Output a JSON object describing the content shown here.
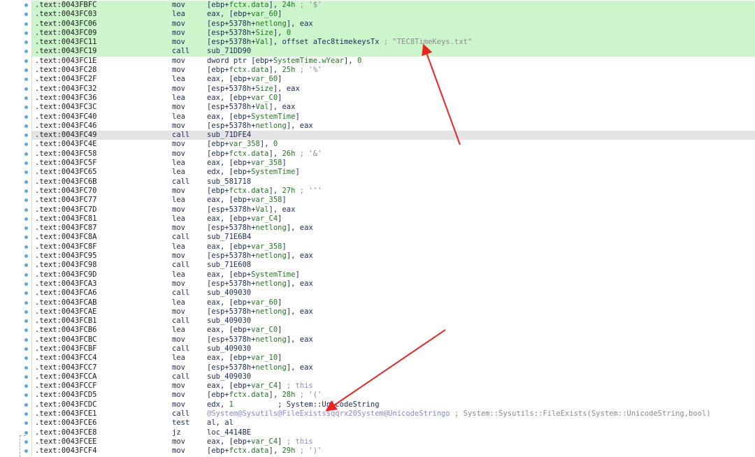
{
  "rows": [
    {
      "addr": ".text:0043FBFC",
      "mn": "mov",
      "ops": [
        [
          "[ebp+",
          "n"
        ],
        [
          "fctx.data",
          "g"
        ],
        [
          "], ",
          "n"
        ],
        [
          "24h",
          "g"
        ],
        [
          " ; '$'",
          "c"
        ]
      ],
      "hl": "green"
    },
    {
      "addr": ".text:0043FC03",
      "mn": "lea",
      "ops": [
        [
          "eax, [ebp+",
          "n"
        ],
        [
          "var_60",
          "g"
        ],
        [
          "]",
          "n"
        ]
      ],
      "hl": "green"
    },
    {
      "addr": ".text:0043FC06",
      "mn": "mov",
      "ops": [
        [
          "[esp+5378h+",
          "n"
        ],
        [
          "netlong",
          "g"
        ],
        [
          "], eax",
          "n"
        ]
      ],
      "hl": "green"
    },
    {
      "addr": ".text:0043FC09",
      "mn": "mov",
      "ops": [
        [
          "[esp+5378h+",
          "n"
        ],
        [
          "Size",
          "g"
        ],
        [
          "], ",
          "n"
        ],
        [
          "0",
          "g"
        ]
      ],
      "hl": "green"
    },
    {
      "addr": ".text:0043FC11",
      "mn": "mov",
      "ops": [
        [
          "[esp+5378h+",
          "n"
        ],
        [
          "Val",
          "g"
        ],
        [
          "], offset aTec8timekeysTx",
          "n"
        ],
        [
          " ; \"TEC8TimeKeys.txt\"",
          "c"
        ]
      ],
      "hl": "green"
    },
    {
      "addr": ".text:0043FC19",
      "mn": "call",
      "ops": [
        [
          "sub_71DD90",
          "n"
        ]
      ],
      "hl": "green"
    },
    {
      "addr": ".text:0043FC1E",
      "mn": "mov",
      "ops": [
        [
          "dword ptr [ebp+",
          "n"
        ],
        [
          "SystemTime.wYear",
          "g"
        ],
        [
          "], ",
          "n"
        ],
        [
          "0",
          "g"
        ]
      ]
    },
    {
      "addr": ".text:0043FC28",
      "mn": "mov",
      "ops": [
        [
          "[ebp+",
          "n"
        ],
        [
          "fctx.data",
          "g"
        ],
        [
          "], ",
          "n"
        ],
        [
          "25h",
          "g"
        ],
        [
          " ; '%'",
          "c"
        ]
      ]
    },
    {
      "addr": ".text:0043FC2F",
      "mn": "lea",
      "ops": [
        [
          "eax, [ebp+",
          "n"
        ],
        [
          "var_60",
          "g"
        ],
        [
          "]",
          "n"
        ]
      ]
    },
    {
      "addr": ".text:0043FC32",
      "mn": "mov",
      "ops": [
        [
          "[esp+5378h+",
          "n"
        ],
        [
          "Size",
          "g"
        ],
        [
          "], eax",
          "n"
        ]
      ]
    },
    {
      "addr": ".text:0043FC36",
      "mn": "lea",
      "ops": [
        [
          "eax, [ebp+",
          "n"
        ],
        [
          "var_C0",
          "g"
        ],
        [
          "]",
          "n"
        ]
      ]
    },
    {
      "addr": ".text:0043FC3C",
      "mn": "mov",
      "ops": [
        [
          "[esp+5378h+",
          "n"
        ],
        [
          "Val",
          "g"
        ],
        [
          "], eax",
          "n"
        ]
      ]
    },
    {
      "addr": ".text:0043FC40",
      "mn": "lea",
      "ops": [
        [
          "eax, [ebp+",
          "n"
        ],
        [
          "SystemTime",
          "g"
        ],
        [
          "]",
          "n"
        ]
      ]
    },
    {
      "addr": ".text:0043FC46",
      "mn": "mov",
      "ops": [
        [
          "[esp+5378h+",
          "n"
        ],
        [
          "netlong",
          "g"
        ],
        [
          "], eax",
          "n"
        ]
      ]
    },
    {
      "addr": ".text:0043FC49",
      "mn": "call",
      "ops": [
        [
          "sub_71DFE4",
          "n"
        ]
      ],
      "hl": "grey"
    },
    {
      "addr": ".text:0043FC4E",
      "mn": "mov",
      "ops": [
        [
          "[ebp+",
          "n"
        ],
        [
          "var_358",
          "g"
        ],
        [
          "], ",
          "n"
        ],
        [
          "0",
          "g"
        ]
      ]
    },
    {
      "addr": ".text:0043FC58",
      "mn": "mov",
      "ops": [
        [
          "[ebp+",
          "n"
        ],
        [
          "fctx.data",
          "g"
        ],
        [
          "], ",
          "n"
        ],
        [
          "26h",
          "g"
        ],
        [
          " ; '&'",
          "c"
        ]
      ]
    },
    {
      "addr": ".text:0043FC5F",
      "mn": "lea",
      "ops": [
        [
          "eax, [ebp+",
          "n"
        ],
        [
          "var_358",
          "g"
        ],
        [
          "]",
          "n"
        ]
      ]
    },
    {
      "addr": ".text:0043FC65",
      "mn": "lea",
      "ops": [
        [
          "edx, [ebp+",
          "n"
        ],
        [
          "SystemTime",
          "g"
        ],
        [
          "]",
          "n"
        ]
      ]
    },
    {
      "addr": ".text:0043FC6B",
      "mn": "call",
      "ops": [
        [
          "sub_581718",
          "n"
        ]
      ]
    },
    {
      "addr": ".text:0043FC70",
      "mn": "mov",
      "ops": [
        [
          "[ebp+",
          "n"
        ],
        [
          "fctx.data",
          "g"
        ],
        [
          "], ",
          "n"
        ],
        [
          "27h",
          "g"
        ],
        [
          " ; '''",
          "c"
        ]
      ]
    },
    {
      "addr": ".text:0043FC77",
      "mn": "lea",
      "ops": [
        [
          "eax, [ebp+",
          "n"
        ],
        [
          "var_358",
          "g"
        ],
        [
          "]",
          "n"
        ]
      ]
    },
    {
      "addr": ".text:0043FC7D",
      "mn": "mov",
      "ops": [
        [
          "[esp+5378h+",
          "n"
        ],
        [
          "Val",
          "g"
        ],
        [
          "], eax",
          "n"
        ]
      ]
    },
    {
      "addr": ".text:0043FC81",
      "mn": "lea",
      "ops": [
        [
          "eax, [ebp+",
          "n"
        ],
        [
          "var_C4",
          "g"
        ],
        [
          "]",
          "n"
        ]
      ]
    },
    {
      "addr": ".text:0043FC87",
      "mn": "mov",
      "ops": [
        [
          "[esp+5378h+",
          "n"
        ],
        [
          "netlong",
          "g"
        ],
        [
          "], eax",
          "n"
        ]
      ]
    },
    {
      "addr": ".text:0043FC8A",
      "mn": "call",
      "ops": [
        [
          "sub_71E6B4",
          "n"
        ]
      ]
    },
    {
      "addr": ".text:0043FC8F",
      "mn": "lea",
      "ops": [
        [
          "eax, [ebp+",
          "n"
        ],
        [
          "var_358",
          "g"
        ],
        [
          "]",
          "n"
        ]
      ]
    },
    {
      "addr": ".text:0043FC95",
      "mn": "mov",
      "ops": [
        [
          "[esp+5378h+",
          "n"
        ],
        [
          "netlong",
          "g"
        ],
        [
          "], eax",
          "n"
        ]
      ]
    },
    {
      "addr": ".text:0043FC98",
      "mn": "call",
      "ops": [
        [
          "sub_71E608",
          "n"
        ]
      ]
    },
    {
      "addr": ".text:0043FC9D",
      "mn": "lea",
      "ops": [
        [
          "eax, [ebp+",
          "n"
        ],
        [
          "SystemTime",
          "g"
        ],
        [
          "]",
          "n"
        ]
      ]
    },
    {
      "addr": ".text:0043FCA3",
      "mn": "mov",
      "ops": [
        [
          "[esp+5378h+",
          "n"
        ],
        [
          "netlong",
          "g"
        ],
        [
          "], eax",
          "n"
        ]
      ]
    },
    {
      "addr": ".text:0043FCA6",
      "mn": "call",
      "ops": [
        [
          "sub_409030",
          "n"
        ]
      ]
    },
    {
      "addr": ".text:0043FCAB",
      "mn": "lea",
      "ops": [
        [
          "eax, [ebp+",
          "n"
        ],
        [
          "var_60",
          "g"
        ],
        [
          "]",
          "n"
        ]
      ]
    },
    {
      "addr": ".text:0043FCAE",
      "mn": "mov",
      "ops": [
        [
          "[esp+5378h+",
          "n"
        ],
        [
          "netlong",
          "g"
        ],
        [
          "], eax",
          "n"
        ]
      ]
    },
    {
      "addr": ".text:0043FCB1",
      "mn": "call",
      "ops": [
        [
          "sub_409030",
          "n"
        ]
      ]
    },
    {
      "addr": ".text:0043FCB6",
      "mn": "lea",
      "ops": [
        [
          "eax, [ebp+",
          "n"
        ],
        [
          "var_C0",
          "g"
        ],
        [
          "]",
          "n"
        ]
      ]
    },
    {
      "addr": ".text:0043FCBC",
      "mn": "mov",
      "ops": [
        [
          "[esp+5378h+",
          "n"
        ],
        [
          "netlong",
          "g"
        ],
        [
          "], eax",
          "n"
        ]
      ]
    },
    {
      "addr": ".text:0043FCBF",
      "mn": "call",
      "ops": [
        [
          "sub_409030",
          "n"
        ]
      ]
    },
    {
      "addr": ".text:0043FCC4",
      "mn": "lea",
      "ops": [
        [
          "eax, [ebp+",
          "n"
        ],
        [
          "var_10",
          "g"
        ],
        [
          "]",
          "n"
        ]
      ]
    },
    {
      "addr": ".text:0043FCC7",
      "mn": "mov",
      "ops": [
        [
          "[esp+5378h+",
          "n"
        ],
        [
          "netlong",
          "g"
        ],
        [
          "], eax",
          "n"
        ]
      ]
    },
    {
      "addr": ".text:0043FCCA",
      "mn": "call",
      "ops": [
        [
          "sub_409030",
          "n"
        ]
      ]
    },
    {
      "addr": ".text:0043FCCF",
      "mn": "mov",
      "ops": [
        [
          "eax, [ebp+",
          "n"
        ],
        [
          "var_C4",
          "g"
        ],
        [
          "] ",
          "n"
        ],
        [
          "; this",
          "f"
        ]
      ]
    },
    {
      "addr": ".text:0043FCD5",
      "mn": "mov",
      "ops": [
        [
          "[ebp+",
          "n"
        ],
        [
          "fctx.data",
          "g"
        ],
        [
          "], ",
          "n"
        ],
        [
          "28h",
          "g"
        ],
        [
          " ; '('",
          "c"
        ]
      ]
    },
    {
      "addr": ".text:0043FCDC",
      "mn": "mov",
      "ops": [
        [
          "edx, ",
          "n"
        ],
        [
          "1",
          "g"
        ],
        [
          "          ; System::UnicodeString",
          "n"
        ]
      ]
    },
    {
      "addr": ".text:0043FCE1",
      "mn": "call",
      "ops": [
        [
          "@System@Sysutils@FileExists$qqrx20System@UnicodeStringo",
          "f"
        ],
        [
          " ; System::Sysutils::FileExists(System::UnicodeString,bool)",
          "c"
        ]
      ]
    },
    {
      "addr": ".text:0043FCE6",
      "mn": "test",
      "ops": [
        [
          "al, al",
          "n"
        ]
      ]
    },
    {
      "addr": ".text:0043FCE8",
      "mn": "jz",
      "ops": [
        [
          "loc_4414BE",
          "n"
        ]
      ]
    },
    {
      "addr": ".text:0043FCEE",
      "mn": "mov",
      "ops": [
        [
          "eax, [ebp+",
          "n"
        ],
        [
          "var_C4",
          "g"
        ],
        [
          "] ",
          "n"
        ],
        [
          "; this",
          "f"
        ]
      ]
    },
    {
      "addr": ".text:0043FCF4",
      "mn": "mov",
      "ops": [
        [
          "[ebp+",
          "n"
        ],
        [
          "fctx.data",
          "g"
        ],
        [
          "], ",
          "n"
        ],
        [
          "29h",
          "g"
        ],
        [
          " ; ')'",
          "c"
        ]
      ]
    }
  ],
  "colors": {
    "highlight": "#ccf5cc",
    "current": "#e4e4e4",
    "arrow": "#ee2222"
  }
}
